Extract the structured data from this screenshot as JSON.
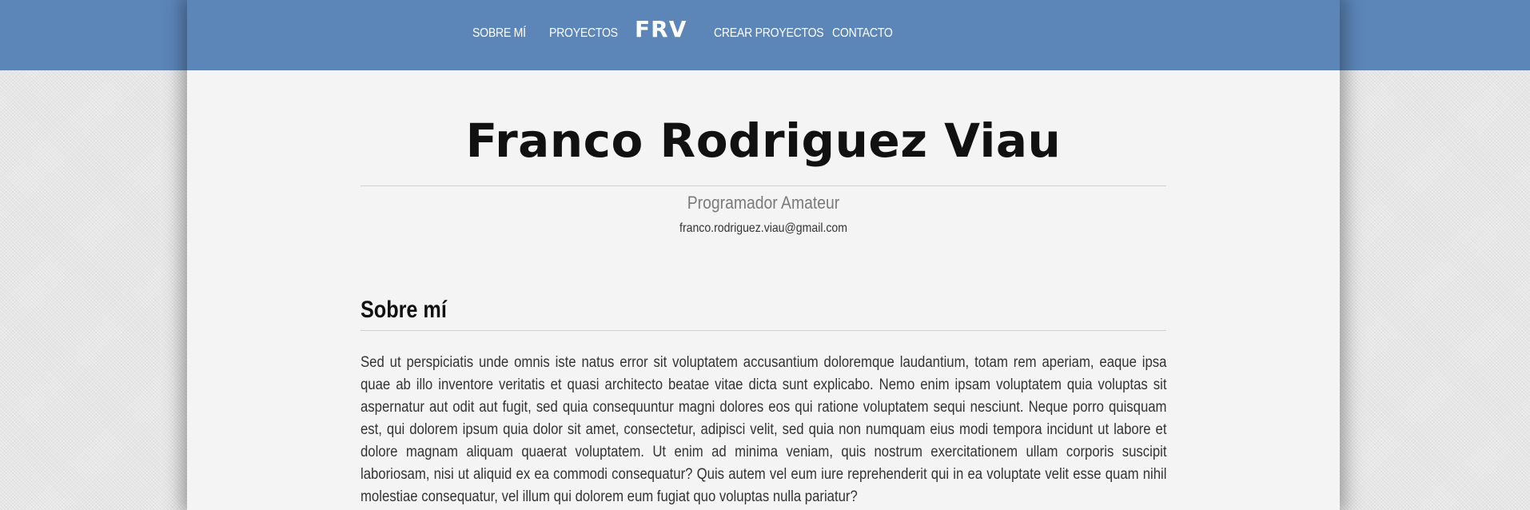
{
  "nav": {
    "items": [
      "SOBRE MÍ",
      "PROYECTOS",
      "CREAR PROYECTOS",
      "CONTACTO"
    ],
    "logo": "FRV"
  },
  "header": {
    "name": "Franco Rodriguez Viau",
    "role": "Programador Amateur",
    "email": "franco.rodriguez.viau@gmail.com"
  },
  "about": {
    "title": "Sobre mí",
    "text": "Sed ut perspiciatis unde omnis iste natus error sit voluptatem accusantium doloremque laudantium, totam rem aperiam, eaque ipsa quae ab illo inventore veritatis et quasi architecto beatae vitae dicta sunt explicabo. Nemo enim ipsam voluptatem quia voluptas sit aspernatur aut odit aut fugit, sed quia consequuntur magni dolores eos qui ratione voluptatem sequi nesciunt. Neque porro quisquam est, qui dolorem ipsum quia dolor sit amet, consectetur, adipisci velit, sed quia non numquam eius modi tempora incidunt ut labore et dolore magnam aliquam quaerat voluptatem. Ut enim ad minima veniam, quis nostrum exercitationem ullam corporis suscipit laboriosam, nisi ut aliquid ex ea commodi consequatur? Quis autem vel eum iure reprehenderit qui in ea voluptate velit esse quam nihil molestiae consequatur, vel illum qui dolorem eum fugiat quo voluptas nulla pariatur?"
  },
  "colors": {
    "nav_background": "#5c85b8",
    "page_background": "#f4f4f4",
    "body_background": "#e6e6e6"
  }
}
